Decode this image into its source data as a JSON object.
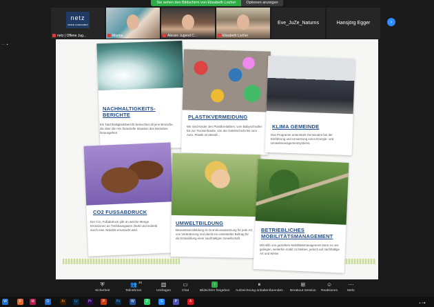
{
  "banner": {
    "sharing_text": "Sie sehen den Bildschirm von Elisabeth Locher",
    "options_label": "Optionen anzeigen"
  },
  "participants": [
    {
      "name": "netz | Offene Jug...",
      "type": "logo",
      "logo_text": "netz",
      "logo_sub": "OFFENE JUGENDARBEIT"
    },
    {
      "name": "Marina",
      "type": "video"
    },
    {
      "name": "Alessio Jugend C...",
      "type": "video"
    },
    {
      "name": "Elisabeth Locher",
      "type": "video"
    },
    {
      "name": "Eve_JuZe_Naturns",
      "type": "name"
    },
    {
      "name": "Hansjörg Egger",
      "type": "name"
    }
  ],
  "next_icon": "chevron-right-icon",
  "shared_cards": [
    {
      "title_1": "NACHHALTIGKEITS-",
      "title_2": "BERICHTE",
      "text": "Ein Nachhaltigkeitsbericht beleuchtet all jene Bereiche, die über die rein finanzielle Situation des Betriebes hinausgehen."
    },
    {
      "title_1": "PLASTIKVERMEIDUNG",
      "title_2": "",
      "text": "Wir sind Kinder des Plastikzeitalters: vom Babyschnuller bis zur Trockenhaube, von der Gelebschicht bis zum Auto. Plastik ist überall..."
    },
    {
      "title_1": "KLIMA GEMEINDE",
      "title_2": "",
      "text": "Das Programm unterstützt Gemeinden bei der Einführung und Umsetzung eines Energie- und Umweltmanagementsystems."
    },
    {
      "title_1": "CO2 FUSSABDRUCK",
      "title_2": "",
      "text": "Der CO₂ Fußabdruck gibt an welche Menge Emissionen an Treibhausgasen direkt und indirekt durch eine Aktivität verursacht wird."
    },
    {
      "title_1": "UMWELTBILDUNG",
      "title_2": "",
      "text": "Bewusstseinsbildung ist Grundvoraussetzung für jede Art von Veränderung und damit ein essentieller Beitrag für die Entwicklung einer nachhaltigen Gesellschaft."
    },
    {
      "title_1": "BETRIEBLICHES",
      "title_2": "MOBILITÄTSMANAGEMENT",
      "text": "Mit Hilfe von gezieltem Mobilitätsmanagement kann es uns gelingen, weiterhin mobil zu bleiben, jedoch auf nachhaltige Art und Weise."
    }
  ],
  "toolbar": {
    "security": "Sicherheit",
    "participants": "Teilnehmer",
    "participants_count": "45",
    "polls": "Umfragen",
    "chat": "Chat",
    "share": "Bildschirm freigeben",
    "record": "Aufzeichnung anhalten/beenden",
    "breakout": "Breakout Session",
    "reactions": "Reaktionen",
    "more": "Mehr"
  },
  "taskbar_apps": [
    "W",
    "F",
    "Id",
    "O",
    "Ai",
    "Lr",
    "Pr",
    "P",
    "Ps",
    "W",
    "Z",
    "S",
    "P",
    "A"
  ]
}
